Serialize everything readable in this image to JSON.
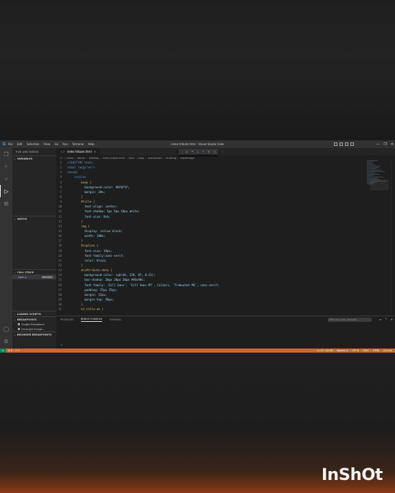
{
  "window": {
    "title": "index tribute.html - Visual Studio Code",
    "menu": [
      "File",
      "Edit",
      "Selection",
      "View",
      "Go",
      "Run",
      "Terminal",
      "Help"
    ]
  },
  "sidebar": {
    "header": "RUN AND DEBUG",
    "sections": {
      "variables": "VARIABLES",
      "watch": "WATCH",
      "call_stack": "CALL STACK",
      "loaded_scripts": "LOADED SCRIPTS",
      "breakpoints": "BREAKPOINTS",
      "browser_breakpoints": "BROWSER BREAKPOINTS"
    },
    "thread": {
      "label": "Open (...",
      "status": "PAUSED"
    },
    "breakpoint_items": [
      "Caught Exceptions",
      "Uncaught Except..."
    ]
  },
  "tab": {
    "label": "index tribute.html",
    "close": "×"
  },
  "breadcrumb": [
    "C:",
    "Users",
    "Admin",
    "Desktop",
    "index tribute.html",
    "html",
    "body",
    "main#main",
    "div#img",
    "img#image"
  ],
  "code_lines": [
    {
      "n": "1",
      "t": "<!DOCTYPE html>"
    },
    {
      "n": "2",
      "t": "<html lang=\"en\">"
    },
    {
      "n": "3",
      "t": "<head>"
    },
    {
      "n": "4",
      "t": "    <style>"
    },
    {
      "n": "5",
      "t": "        body {"
    },
    {
      "n": "6",
      "t": "          background-color: #0f0f5f;"
    },
    {
      "n": "7",
      "t": "          margin: 20%;"
    },
    {
      "n": "8",
      "t": "        }"
    },
    {
      "n": "9",
      "t": "        #title {"
    },
    {
      "n": "10",
      "t": "          text-align: center;"
    },
    {
      "n": "11",
      "t": "          text-shadow: 5px 5px 10px white;"
    },
    {
      "n": "12",
      "t": "          font-size: 8vh;"
    },
    {
      "n": "13",
      "t": "        }"
    },
    {
      "n": "14",
      "t": "        img {"
    },
    {
      "n": "15",
      "t": "          display: inline block;"
    },
    {
      "n": "16",
      "t": "          width: 100%;"
    },
    {
      "n": "17",
      "t": "        }"
    },
    {
      "n": "18",
      "t": "        #caption {"
    },
    {
      "n": "19",
      "t": "          font-size: 19px;"
    },
    {
      "n": "20",
      "t": "          font-family:sans-serif;"
    },
    {
      "n": "21",
      "t": "          color: black;"
    },
    {
      "n": "22",
      "t": "        }"
    },
    {
      "n": "23",
      "t": "        div#tribute-data {"
    },
    {
      "n": "24",
      "t": "          background-color: rgb(46, 139, 87, 0.21);"
    },
    {
      "n": "25",
      "t": "          box-shadow: 20px 20px 20px #46c90c;"
    },
    {
      "n": "26",
      "t": "          font-family: 'Gill Sans', 'Gill Sans MT', Calibri, 'Trebuchet MS', sans-serif;"
    },
    {
      "n": "27",
      "t": "          padding: 25px 25px;"
    },
    {
      "n": "28",
      "t": "          margin: 15px;"
    },
    {
      "n": "29",
      "t": "          margin-top: 50px;"
    },
    {
      "n": "30",
      "t": "        }"
    },
    {
      "n": "31",
      "t": "        h1.title-ak {"
    }
  ],
  "panel": {
    "tabs": [
      "PROBLEMS",
      "DEBUG CONSOLE",
      "TERMINAL"
    ],
    "filter_placeholder": "Filter (e.g. text, !exclude)",
    "prompt": ">"
  },
  "status": {
    "left": [
      "⊗ 0",
      "⚠ 0"
    ],
    "right": [
      "Ln 47, Col 48",
      "Spaces: 4",
      "UTF-8",
      "CRLF",
      "HTML",
      "Go Live"
    ]
  },
  "watermark": "InShOt",
  "colors": {
    "statusbar": "#cc6633",
    "accent": "#3ea6ff"
  }
}
